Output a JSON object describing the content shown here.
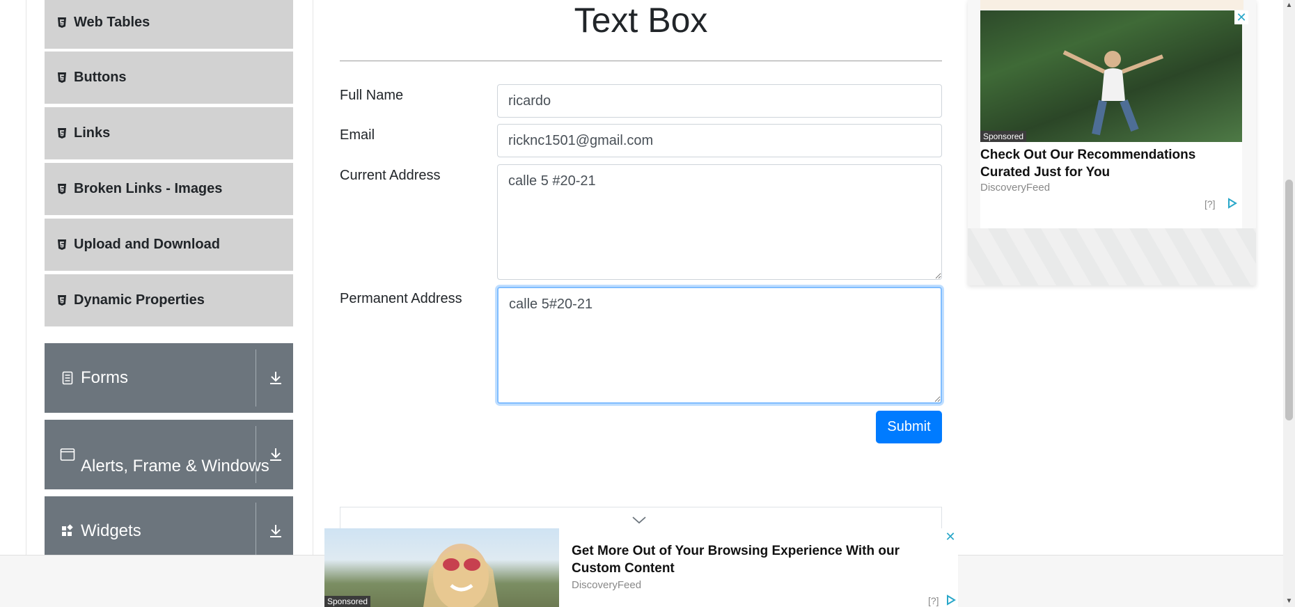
{
  "sidebar": {
    "items": [
      {
        "label": "Web Tables"
      },
      {
        "label": "Buttons"
      },
      {
        "label": "Links"
      },
      {
        "label": "Broken Links - Images"
      },
      {
        "label": "Upload and Download"
      },
      {
        "label": "Dynamic Properties"
      }
    ],
    "groups": [
      {
        "label": "Forms"
      },
      {
        "label": "Alerts, Frame & Windows"
      },
      {
        "label": "Widgets"
      }
    ]
  },
  "main": {
    "title": "Text Box",
    "fields": {
      "full_name": {
        "label": "Full Name",
        "value": "ricardo"
      },
      "email": {
        "label": "Email",
        "value": "ricknc1501@gmail.com"
      },
      "current_address": {
        "label": "Current Address",
        "value": "calle 5 #20-21"
      },
      "permanent_address": {
        "label": "Permanent Address",
        "value": "calle 5#20-21"
      }
    },
    "submit_label": "Submit"
  },
  "ad_right": {
    "sponsored": "Sponsored",
    "headline": "Check Out Our Recommendations Curated Just for You",
    "source": "DiscoveryFeed",
    "info": "[?]"
  },
  "ad_bottom": {
    "sponsored": "Sponsored",
    "headline": "Get More Out of Your Browsing Experience With our Custom Content",
    "source": "DiscoveryFeed",
    "info": "[?]"
  },
  "colors": {
    "accent": "#007bff",
    "sidebar_item_bg": "#d2d2d2",
    "group_bg": "#6c757d",
    "focus_border": "#80bdff"
  }
}
